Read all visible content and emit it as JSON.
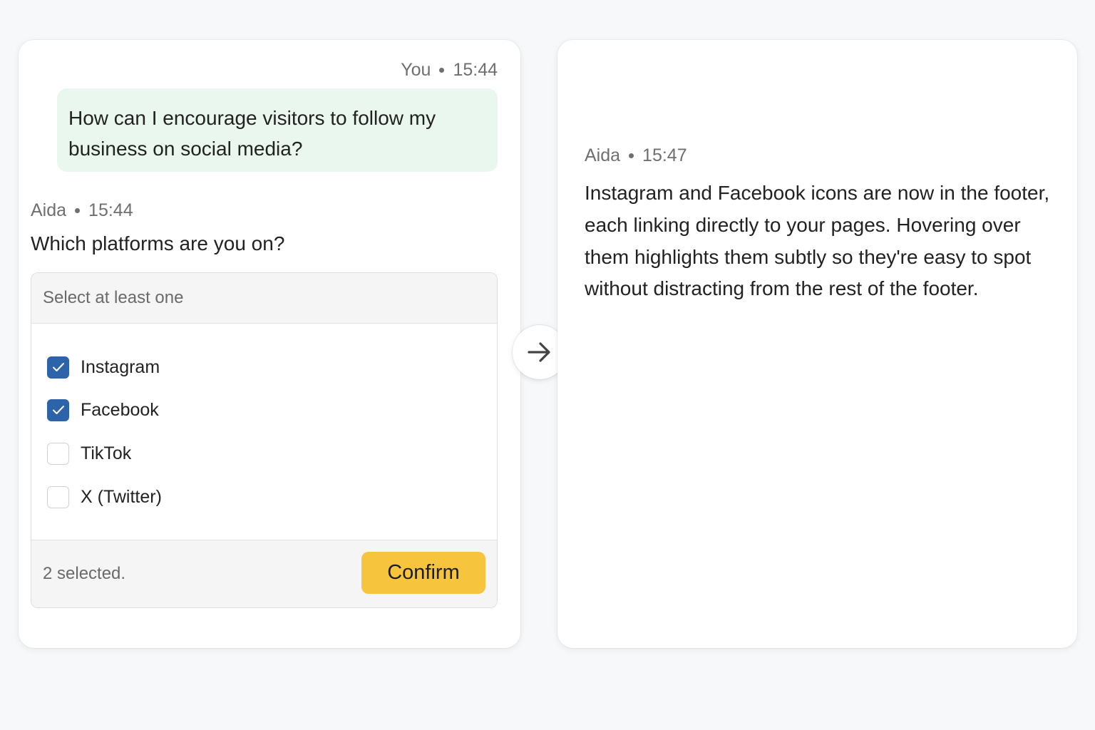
{
  "left_panel": {
    "user_message": {
      "author": "You",
      "time": "15:44",
      "text": "How can I encourage visitors to follow my business on social media?"
    },
    "aida_message": {
      "author": "Aida",
      "time": "15:44",
      "text": "Which platforms are you on?"
    },
    "select": {
      "placeholder": "Select at least one",
      "options": [
        {
          "label": "Instagram",
          "checked": true
        },
        {
          "label": "Facebook",
          "checked": true
        },
        {
          "label": "TikTok",
          "checked": false
        },
        {
          "label": "X (Twitter)",
          "checked": false
        }
      ],
      "selected_count_text": "2 selected.",
      "confirm_label": "Confirm"
    }
  },
  "arrow_icon": "arrow-right-icon",
  "right_panel": {
    "aida_message": {
      "author": "Aida",
      "time": "15:47",
      "text": "Instagram and Facebook icons are now in the footer, each linking directly to your pages. Hovering over them highlights them subtly so they're easy to spot without distracting from the rest of the footer."
    }
  },
  "colors": {
    "user_bubble": "#e9f7ee",
    "checkbox_checked": "#2d63a8",
    "confirm_button": "#f7c53d",
    "background": "#f7f8fa"
  }
}
